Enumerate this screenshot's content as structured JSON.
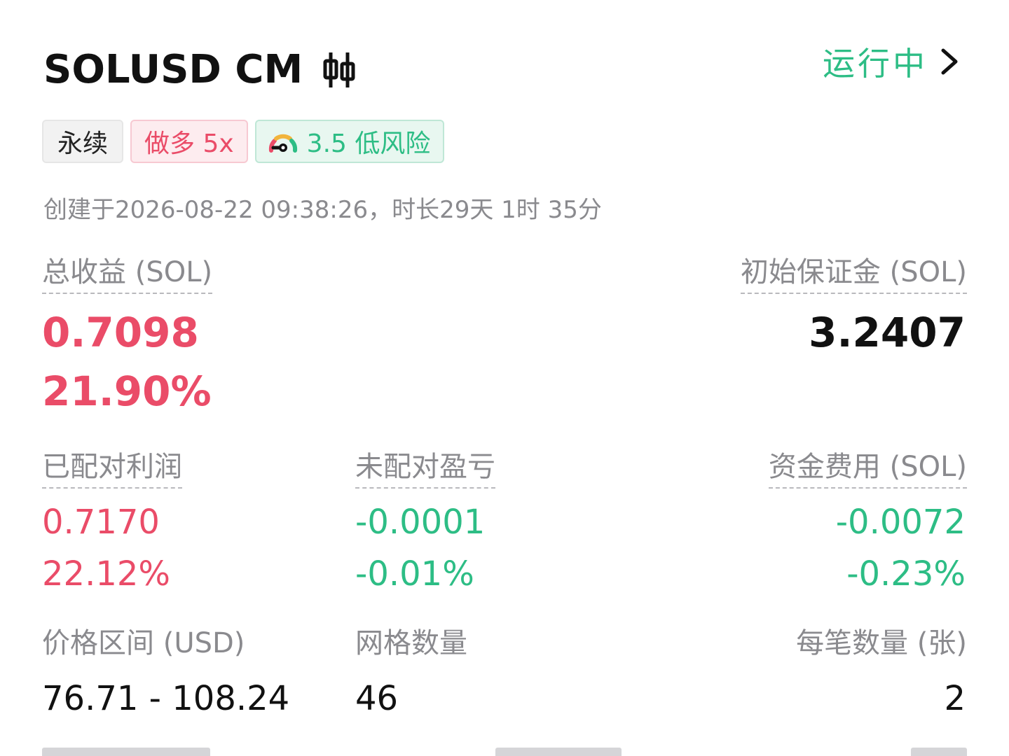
{
  "header": {
    "title": "SOLUSD CM",
    "status": "运行中",
    "icons": {
      "chart": "candlestick-icon",
      "status": "chevron-right-icon",
      "risk": "gauge-icon"
    }
  },
  "tags": {
    "perpetual": "永续",
    "direction": "做多 5x",
    "risk": "3.5 低风险"
  },
  "created": "创建于2026-08-22 09:38:26，时长29天 1时 35分",
  "total_pnl": {
    "label": "总收益 (SOL)",
    "value": "0.7098",
    "percent": "21.90%"
  },
  "initial_margin": {
    "label": "初始保证金 (SOL)",
    "value": "3.2407"
  },
  "matched_profit": {
    "label": "已配对利润",
    "value": "0.7170",
    "percent": "22.12%"
  },
  "unmatched_pnl": {
    "label": "未配对盈亏",
    "value": "-0.0001",
    "percent": "-0.01%"
  },
  "funding_fee": {
    "label": "资金费用 (SOL)",
    "value": "-0.0072",
    "percent": "-0.23%"
  },
  "price_range": {
    "label": "价格区间 (USD)",
    "value": "76.71 - 108.24"
  },
  "grid_count": {
    "label": "网格数量",
    "value": "46"
  },
  "qty_per_order": {
    "label": "每笔数量 (张)",
    "value": "2"
  },
  "colors": {
    "profit": "#ea4c68",
    "loss": "#2dbd85",
    "muted": "#8a8a8e",
    "text": "#111111"
  }
}
